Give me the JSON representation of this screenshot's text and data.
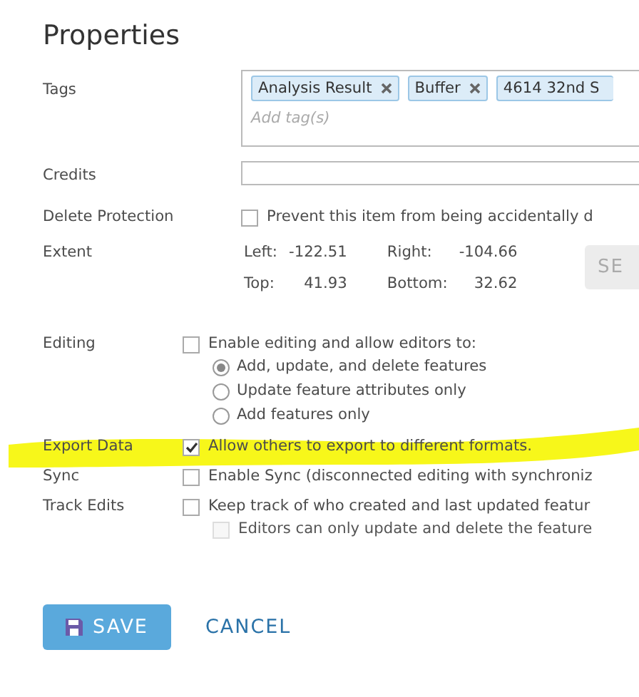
{
  "title": "Properties",
  "tags": {
    "label": "Tags",
    "items": [
      "Analysis Result",
      "Buffer",
      "4614 32nd S"
    ],
    "placeholder": "Add tag(s)"
  },
  "credits": {
    "label": "Credits"
  },
  "delete_protection": {
    "label": "Delete Protection",
    "checked": false,
    "text": "Prevent this item from being accidentally d"
  },
  "extent": {
    "label": "Extent",
    "rows": [
      {
        "a_label": "Left:",
        "a": "-122.51",
        "b_label": "Right:",
        "b": "-104.66"
      },
      {
        "a_label": "Top:",
        "a": "41.93",
        "b_label": "Bottom:",
        "b": "32.62"
      }
    ],
    "button": "SE"
  },
  "settings": [
    {
      "label": "Editing",
      "checked": false,
      "highlighted": false,
      "text": "Enable editing and allow editors to:",
      "options": [
        {
          "text": "Add, update, and delete features",
          "selected": true
        },
        {
          "text": "Update feature attributes only",
          "selected": false
        },
        {
          "text": "Add features only",
          "selected": false
        }
      ]
    },
    {
      "label": "Export Data",
      "checked": true,
      "highlighted": true,
      "text": "Allow others to export to different formats."
    },
    {
      "label": "Sync",
      "checked": false,
      "highlighted": false,
      "text": "Enable Sync (disconnected editing with synchroniz"
    },
    {
      "label": "Track Edits",
      "checked": false,
      "highlighted": false,
      "text": "Keep track of who created and last updated featur",
      "sub": [
        {
          "text": "Editors can only update and delete the feature",
          "checked": false,
          "disabled": true
        }
      ]
    }
  ],
  "buttons": {
    "save": "SAVE",
    "cancel": "CANCEL"
  }
}
